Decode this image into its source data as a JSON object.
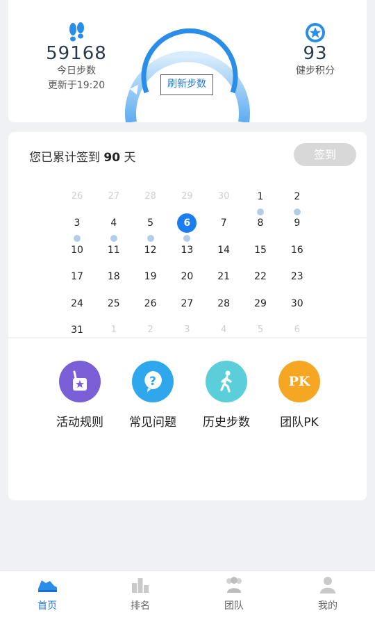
{
  "stats": {
    "steps_value": "59168",
    "steps_label": "今日步数",
    "updated_text": "更新于19:20",
    "points_value": "93",
    "points_label": "健步积分",
    "refresh_label": "刷新步数",
    "steps_icon": "footprints-icon",
    "points_icon": "star-badge-icon",
    "accent_color": "#2a8de8"
  },
  "signin": {
    "prefix": "您已累计签到",
    "days": "90",
    "suffix": "天",
    "button_label": "签到",
    "button_color": "#d8d8d8"
  },
  "calendar": {
    "rows": [
      [
        {
          "d": "26",
          "o": true
        },
        {
          "d": "27",
          "o": true
        },
        {
          "d": "28",
          "o": true
        },
        {
          "d": "29",
          "o": true
        },
        {
          "d": "30",
          "o": true
        },
        {
          "d": "1",
          "dot": true
        },
        {
          "d": "2",
          "dot": true
        }
      ],
      [
        {
          "d": "3",
          "dot": true
        },
        {
          "d": "4",
          "dot": true
        },
        {
          "d": "5",
          "dot": true
        },
        {
          "d": "6",
          "today": true,
          "dot": true
        },
        {
          "d": "7"
        },
        {
          "d": "8"
        },
        {
          "d": "9"
        }
      ],
      [
        {
          "d": "10"
        },
        {
          "d": "11"
        },
        {
          "d": "12"
        },
        {
          "d": "13"
        },
        {
          "d": "14"
        },
        {
          "d": "15"
        },
        {
          "d": "16"
        }
      ],
      [
        {
          "d": "17"
        },
        {
          "d": "18"
        },
        {
          "d": "19"
        },
        {
          "d": "20"
        },
        {
          "d": "21"
        },
        {
          "d": "22"
        },
        {
          "d": "23"
        }
      ],
      [
        {
          "d": "24"
        },
        {
          "d": "25"
        },
        {
          "d": "26"
        },
        {
          "d": "27"
        },
        {
          "d": "28"
        },
        {
          "d": "29"
        },
        {
          "d": "30"
        }
      ],
      [
        {
          "d": "31"
        },
        {
          "d": "1",
          "o": true
        },
        {
          "d": "2",
          "o": true
        },
        {
          "d": "3",
          "o": true
        },
        {
          "d": "4",
          "o": true
        },
        {
          "d": "5",
          "o": true
        },
        {
          "d": "6",
          "o": true
        }
      ]
    ],
    "today_color": "#1a7ef0",
    "dot_color": "#b3cde9"
  },
  "menu": {
    "items": [
      {
        "label": "活动规则",
        "icon": "gift-bag-icon",
        "color": "#7b5fd6"
      },
      {
        "label": "常见问题",
        "icon": "question-bubble-icon",
        "color": "#2ea7ec"
      },
      {
        "label": "历史步数",
        "icon": "walking-person-icon",
        "color": "#5bcfd9"
      },
      {
        "label": "团队PK",
        "icon": "pk-icon",
        "color": "#f5a623"
      }
    ],
    "pk_icon_text": "PK"
  },
  "tabbar": {
    "tabs": [
      {
        "label": "首页",
        "icon": "sneaker-icon",
        "active": true
      },
      {
        "label": "排名",
        "icon": "ranking-icon",
        "active": false
      },
      {
        "label": "团队",
        "icon": "team-icon",
        "active": false
      },
      {
        "label": "我的",
        "icon": "profile-icon",
        "active": false
      }
    ]
  }
}
